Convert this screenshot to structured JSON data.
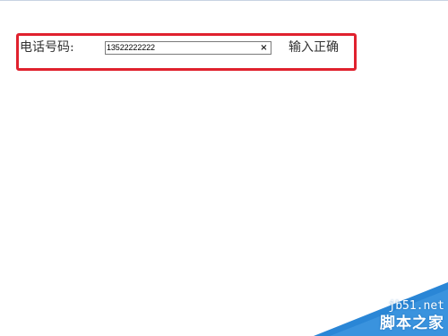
{
  "form": {
    "phone_label": "电话号码:",
    "phone_value": "13522222222",
    "clear_glyph": "×",
    "validation_message": "输入正确"
  },
  "watermark": {
    "domain": "jb51.net",
    "site_name": "脚本之家"
  },
  "colors": {
    "highlight_border": "#e0212e",
    "watermark_blue": "#2a86d6"
  },
  "icons": {
    "clear": "close-icon"
  }
}
